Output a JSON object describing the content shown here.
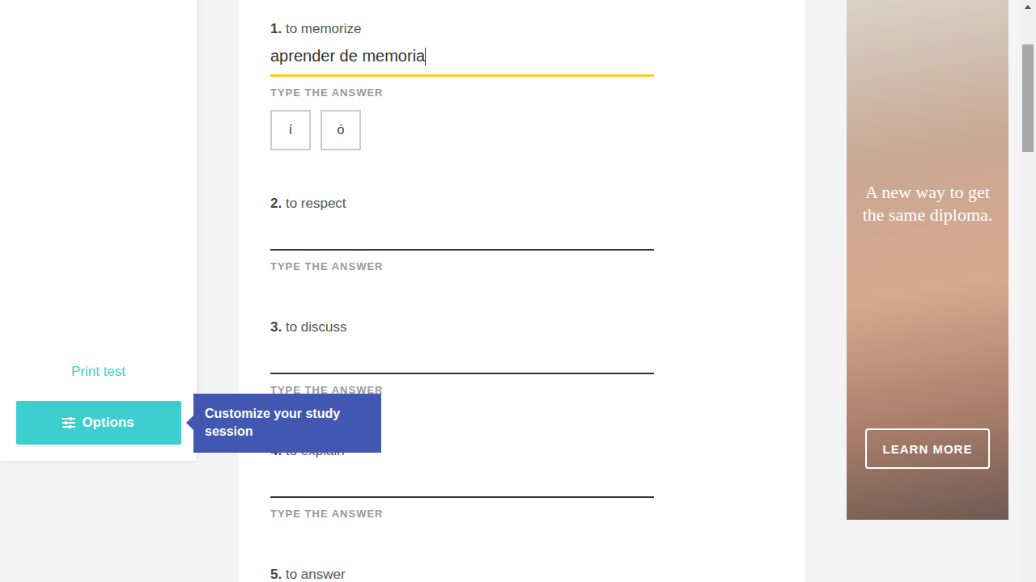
{
  "sidebar": {
    "print_link": "Print test",
    "options_button": "Options",
    "tooltip": "Customize your study session"
  },
  "questions": [
    {
      "number": "1.",
      "prompt": "to memorize",
      "answer": "aprender de memoria",
      "hint": "TYPE THE ANSWER",
      "focused": true
    },
    {
      "number": "2.",
      "prompt": "to respect",
      "answer": "",
      "hint": "TYPE THE ANSWER",
      "focused": false
    },
    {
      "number": "3.",
      "prompt": "to discuss",
      "answer": "",
      "hint": "TYPE THE ANSWER",
      "focused": false
    },
    {
      "number": "4.",
      "prompt": "to explain",
      "answer": "",
      "hint": "TYPE THE ANSWER",
      "focused": false
    },
    {
      "number": "5.",
      "prompt": "to answer",
      "answer": "",
      "hint": "TYPE THE ANSWER",
      "focused": false
    }
  ],
  "accents": [
    "í",
    "ó"
  ],
  "ad": {
    "headline": "A new way to get the same diploma.",
    "button": "LEARN MORE"
  },
  "scrollbar": {
    "level": 0.2
  }
}
